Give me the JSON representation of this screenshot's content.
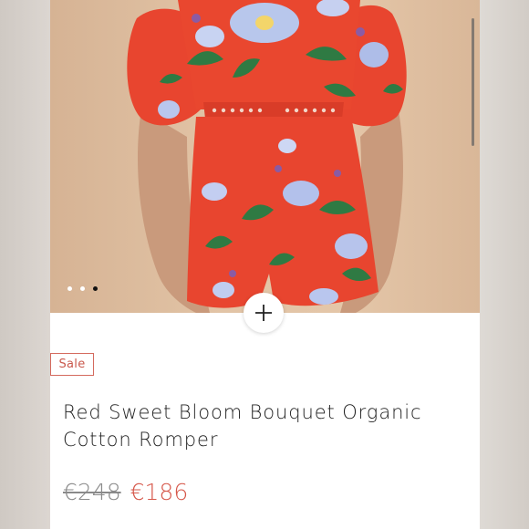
{
  "product": {
    "badge": "Sale",
    "title": "Red Sweet Bloom Bouquet Organic Cotton Romper",
    "original_price": "€248",
    "sale_price": "€186"
  },
  "gallery": {
    "image_count": 3,
    "active_index": 2,
    "zoom_icon": "plus-icon"
  },
  "colors": {
    "accent": "#d6574a",
    "badge_border": "#d46a5e",
    "garment_red": "#e8452f",
    "muted_text": "#8a8a8a"
  }
}
